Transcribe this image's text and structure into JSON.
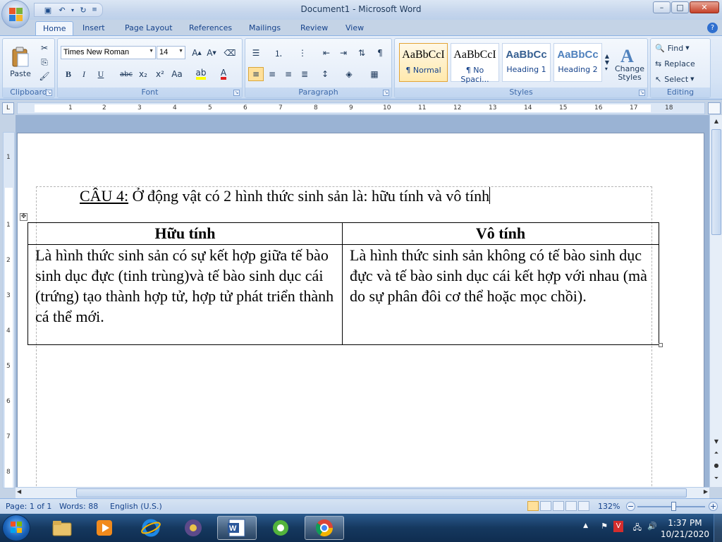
{
  "window": {
    "title": "Document1 - Microsoft Word",
    "minimize": "–",
    "maximize": "□",
    "close": "✕"
  },
  "quick_access": [
    {
      "name": "save-icon",
      "glyph": "▣"
    },
    {
      "name": "undo-icon",
      "glyph": "↶"
    },
    {
      "name": "undo-dropdown-icon",
      "glyph": "▾"
    },
    {
      "name": "redo-icon",
      "glyph": "↻"
    },
    {
      "name": "customize-qat-icon",
      "glyph": "≡"
    }
  ],
  "tabs": [
    "Home",
    "Insert",
    "Page Layout",
    "References",
    "Mailings",
    "Review",
    "View"
  ],
  "ribbon": {
    "clipboard": {
      "label": "Clipboard",
      "paste": "Paste"
    },
    "font": {
      "label": "Font",
      "font_name": "Times New Roman",
      "font_size": "14"
    },
    "paragraph": {
      "label": "Paragraph"
    },
    "styles": {
      "label": "Styles",
      "items": [
        {
          "sample": "AaBbCcI",
          "name": "¶ Normal"
        },
        {
          "sample": "AaBbCcI",
          "name": "¶ No Spaci..."
        },
        {
          "sample": "AaBbCc",
          "name": "Heading 1"
        },
        {
          "sample": "AaBbCc",
          "name": "Heading 2"
        }
      ],
      "change_styles": "Change Styles"
    },
    "editing": {
      "label": "Editing",
      "find": "Find",
      "replace": "Replace",
      "select": "Select"
    }
  },
  "ruler": {
    "h_numbers": [
      "1",
      "1",
      "2",
      "3",
      "4",
      "5",
      "6",
      "7",
      "8",
      "9",
      "10",
      "11",
      "12",
      "13",
      "14",
      "15",
      "16",
      "17",
      "18"
    ],
    "v_numbers": [
      "1",
      "1",
      "2",
      "3",
      "4",
      "5",
      "6",
      "7",
      "8"
    ]
  },
  "document": {
    "heading_prefix": "CÂU 4:",
    "heading_rest": " Ở động vật có 2 hình thức sinh sản là: hữu tính và vô tính",
    "table": {
      "headers": [
        "Hữu  tính",
        "Vô tính"
      ],
      "rows": [
        [
          "Là hình thức sinh sản có sự kết hợp giữa tế bào sinh dục đực (tinh trùng)và tế bào sinh dục cái (trứng) tạo thành hợp tử, hợp tử phát triển thành cá thể mới.",
          "Là hình thức sinh sản không có tế bào sinh dục đực và tế bào sinh dục cái kết hợp với nhau (mà do sự phân đôi cơ thể hoặc mọc chồi)."
        ]
      ]
    }
  },
  "status": {
    "page": "Page: 1 of 1",
    "words": "Words: 88",
    "language": "English (U.S.)",
    "zoom": "132%"
  },
  "taskbar": {
    "time": "1:37 PM",
    "date": "10/21/2020"
  }
}
